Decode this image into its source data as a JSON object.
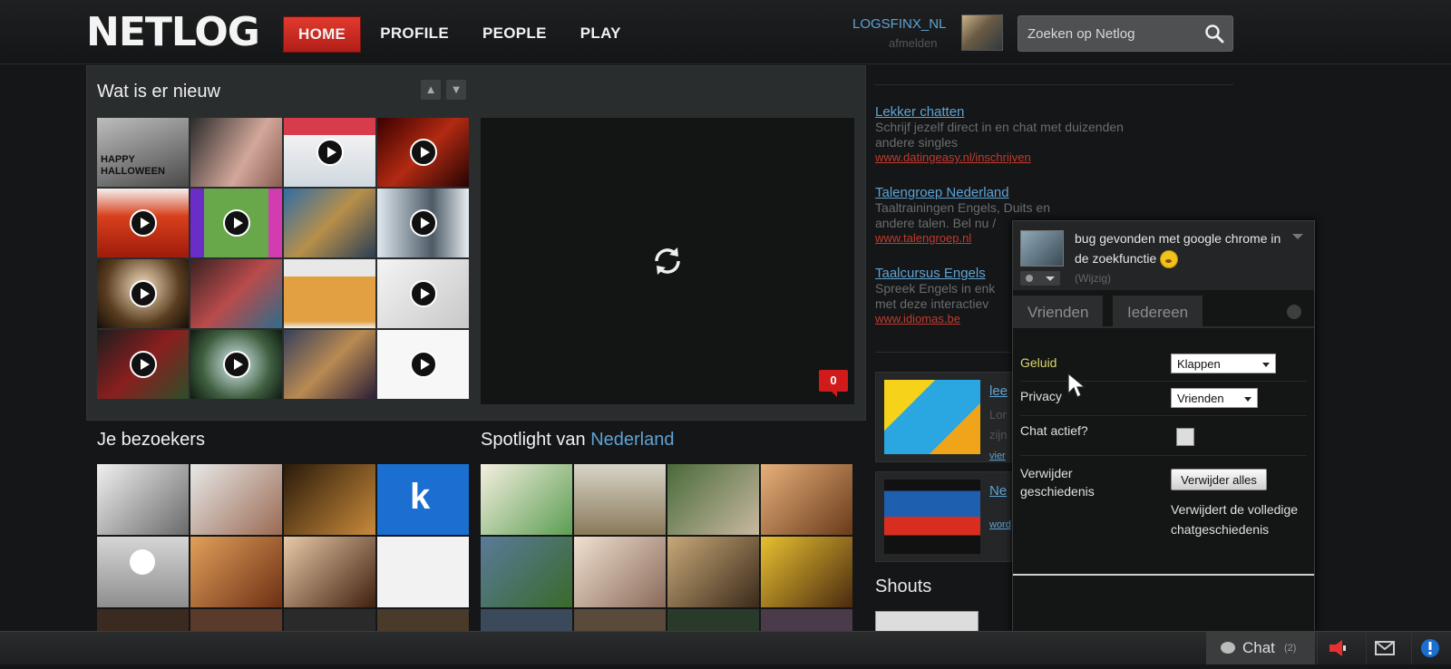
{
  "header": {
    "logo": "NETLOG",
    "nav": [
      "HOME",
      "PROFILE",
      "PEOPLE",
      "PLAY"
    ],
    "active_nav": "HOME",
    "username": "LOGSFINX_NL",
    "logout": "afmelden",
    "search_placeholder": "Zoeken op Netlog"
  },
  "whats_new": {
    "title": "Wat is er nieuw",
    "comment_count": "0",
    "halloween_text": "HAPPY HALLOWEEN"
  },
  "visitors": {
    "title": "Je bezoekers"
  },
  "spotlight": {
    "title_prefix": "Spotlight van",
    "title_location": "Nederland"
  },
  "ads": [
    {
      "title": "Lekker chatten",
      "body": "Schrijf jezelf direct in en chat met duizenden andere singles",
      "url": "www.datingeasy.nl/inschrijven"
    },
    {
      "title": "Talengroep Nederland",
      "body": "Taaltrainingen Engels, Duits en andere talen. Bel nu /",
      "url": "www.talengroep.nl"
    },
    {
      "title": "Taalcursus Engels",
      "body": "Spreek Engels in enk met deze interactiev",
      "url": "www.idiomas.be"
    }
  ],
  "promos": [
    {
      "link": "lee",
      "text": [
        "Lor",
        "zijn",
        "vier"
      ]
    },
    {
      "link": "Ne",
      "text": [
        "word"
      ]
    }
  ],
  "shouts": {
    "title": "Shouts"
  },
  "chat_popup": {
    "status_message": "bug gevonden met google chrome in de zoekfunctie",
    "edit_link": "(Wijzig)",
    "tabs": [
      "Vrienden",
      "Iedereen"
    ],
    "settings": {
      "sound_label": "Geluid",
      "sound_value": "Klappen",
      "privacy_label": "Privacy",
      "privacy_value": "Vrienden",
      "chat_active_label": "Chat actief?",
      "chat_active_checked": false,
      "history_label_1": "Verwijder",
      "history_label_2": "geschiedenis",
      "clear_button": "Verwijder alles",
      "clear_description": "Verwijdert de volledige chatgeschiedenis"
    }
  },
  "bottom_bar": {
    "chat_label": "Chat",
    "chat_count": "(2)"
  },
  "colors": {
    "accent_red": "#d11b1b",
    "link_blue": "#5fa3d4",
    "ad_url_red": "#c23a2e",
    "background": "#141617"
  }
}
